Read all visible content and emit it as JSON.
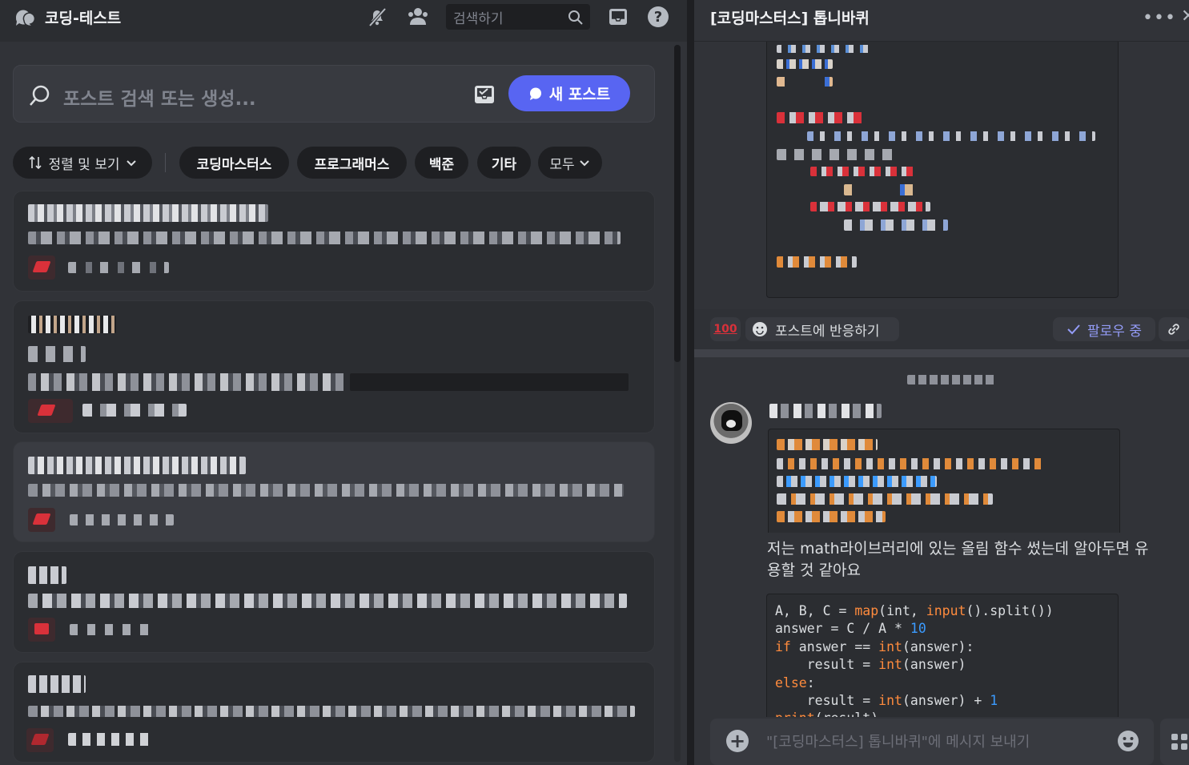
{
  "left_header": {
    "channel_title": "코딩-테스트",
    "search_placeholder": "검색하기",
    "icons": [
      "forum-channel-icon",
      "mute-bell-icon",
      "members-icon",
      "search-icon",
      "inbox-icon",
      "help-icon"
    ]
  },
  "post_search": {
    "placeholder": "포스트 검색 또는 생성...",
    "new_post_label": "새 포스트"
  },
  "filters": {
    "sort_label": "정렬 및 보기",
    "tags": [
      "코딩마스터스",
      "프로그래머스",
      "백준",
      "기타"
    ],
    "all_label": "모두"
  },
  "colors": {
    "accent": "#5865f2",
    "background": "#313338",
    "card": "#2b2d31",
    "code_keyword": "#ff8b3d",
    "code_number": "#3b9bff",
    "follow_text": "#949cf7"
  },
  "thread": {
    "title": "[코딩마스터스] 톱니바퀴",
    "reaction_emoji_label": "100",
    "react_label": "포스트에 반응하기",
    "follow_label": "팔로우 중",
    "message_text": "저는 math라이브러리에 있는 올림 함수 썼는데 알아두면 유용할 것 같아요",
    "code_lines": [
      "A, B, C = map(int, input().split())",
      "answer = C / A * 10",
      "if answer == int(answer):",
      "    result = int(answer)",
      "else:",
      "    result = int(answer) + 1",
      "print(result)"
    ],
    "composer_placeholder": "\"[코딩마스터스] 톱니바퀴\"에 메시지 보내기"
  }
}
